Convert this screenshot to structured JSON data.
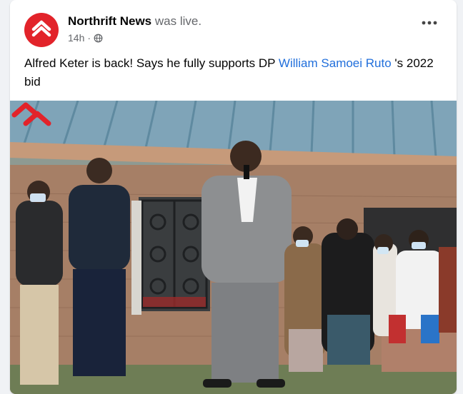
{
  "post": {
    "page_name": "Northrift News",
    "live_status": "was live.",
    "time": "14h",
    "text_before": "Alfred Keter is back! Says he fully supports DP ",
    "mention": "William Samoei Ruto",
    "text_after": " 's 2022 bid"
  },
  "icons": {
    "avatar": "northrift-logo",
    "privacy": "globe-icon",
    "menu": "more-options-icon",
    "watermark": "northrift-logo"
  },
  "colors": {
    "brand": "#e2232a",
    "link": "#216fdb",
    "secondary_text": "#65676b"
  }
}
